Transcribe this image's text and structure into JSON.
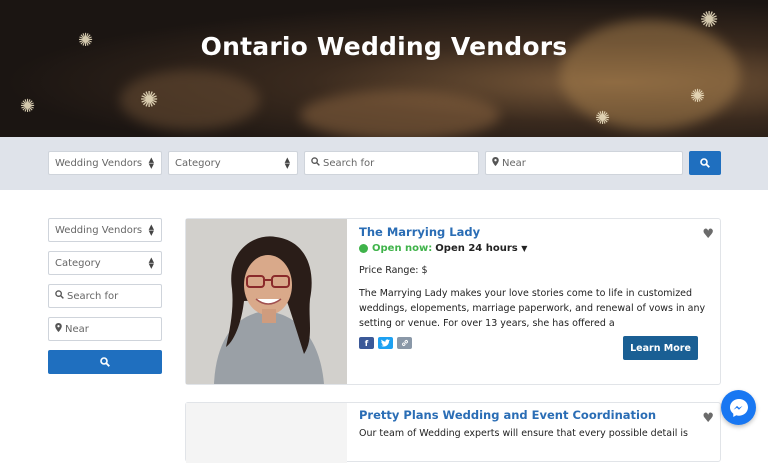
{
  "hero": {
    "title": "Ontario Wedding Vendors"
  },
  "search_bar": {
    "type_select": "Wedding Vendors",
    "category_select": "Category",
    "search_placeholder": "Search for",
    "near_placeholder": "Near"
  },
  "sidebar": {
    "type_select": "Wedding Vendors",
    "category_select": "Category",
    "search_placeholder": "Search for",
    "near_placeholder": "Near"
  },
  "listings": [
    {
      "title": "The Marrying Lady",
      "open_status": "Open now:",
      "hours": "Open 24 hours",
      "price_range": "Price Range: $",
      "description": "The Marrying Lady makes your love stories come to life in customized weddings, elopements, marriage paperwork, and renewal of vows in any setting or venue. For over 13 years, she has offered a",
      "learn_more": "Learn More",
      "social": [
        "f",
        "t",
        "link"
      ]
    },
    {
      "title": "Pretty Plans Wedding and Event Coordination",
      "description": "Our team of Wedding experts will ensure that every possible detail is"
    }
  ],
  "colors": {
    "accent": "#1f6fbf",
    "link": "#2a6db5",
    "open": "#3fb34a",
    "learn_more": "#1a5f94"
  }
}
